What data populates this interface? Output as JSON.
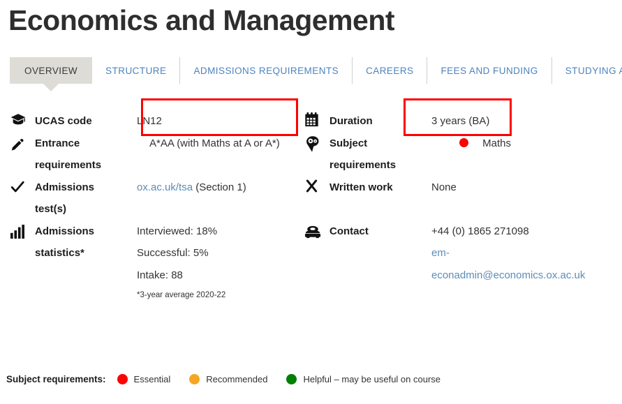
{
  "page": {
    "title": "Economics and Management"
  },
  "tabs": [
    {
      "label": "OVERVIEW",
      "active": true
    },
    {
      "label": "STRUCTURE",
      "active": false
    },
    {
      "label": "ADMISSIONS REQUIREMENTS",
      "active": false
    },
    {
      "label": "CAREERS",
      "active": false
    },
    {
      "label": "FEES AND FUNDING",
      "active": false
    },
    {
      "label": "STUDYING AT OXFORD",
      "active": false
    }
  ],
  "left_column": {
    "ucas": {
      "icon": "graduation-cap-icon",
      "label": "UCAS code",
      "value": "LN12"
    },
    "entrance": {
      "icon": "pencil-icon",
      "label_line1": "Entrance",
      "label_line2": "requirements",
      "value": "A*AA (with Maths at A or A*)",
      "highlighted": true
    },
    "admissions_test": {
      "icon": "check-icon",
      "label_line1": "Admissions",
      "label_line2": "test(s)",
      "link_text": "ox.ac.uk/tsa",
      "value_suffix": " (Section 1)"
    },
    "admissions_stats": {
      "icon": "bar-chart-icon",
      "label_line1": "Admissions",
      "label_line2": "statistics*",
      "lines": [
        "Interviewed: 18%",
        "Successful: 5%",
        "Intake: 88"
      ],
      "footnote": "*3-year average 2020-22"
    }
  },
  "right_column": {
    "duration": {
      "icon": "calendar-icon",
      "label": "Duration",
      "value": "3 years (BA)"
    },
    "subject_requirements": {
      "icon": "head-gears-icon",
      "label_line1": "Subject",
      "label_line2": "requirements",
      "dot_color": "#ff0000",
      "value": "Maths",
      "highlighted": true
    },
    "written_work": {
      "icon": "cross-icon",
      "label": "Written work",
      "value": "None"
    },
    "contact": {
      "icon": "telephone-icon",
      "label": "Contact",
      "phone": "+44 (0) 1865 271098",
      "email_line1": "em-",
      "email_line2": "econadmin@economics.ox.ac.uk"
    }
  },
  "legend": {
    "title": "Subject requirements:",
    "items": [
      {
        "color": "#ff0000",
        "label": "Essential"
      },
      {
        "color": "#f5a623",
        "label": "Recommended"
      },
      {
        "color": "#008000",
        "label": "Helpful – may be useful on course"
      }
    ]
  },
  "colors": {
    "link": "#5b8db8",
    "tab_active_bg": "#dedcd7",
    "highlight_border": "#ff0000",
    "essential": "#ff0000",
    "recommended": "#f5a623",
    "helpful": "#008000"
  }
}
